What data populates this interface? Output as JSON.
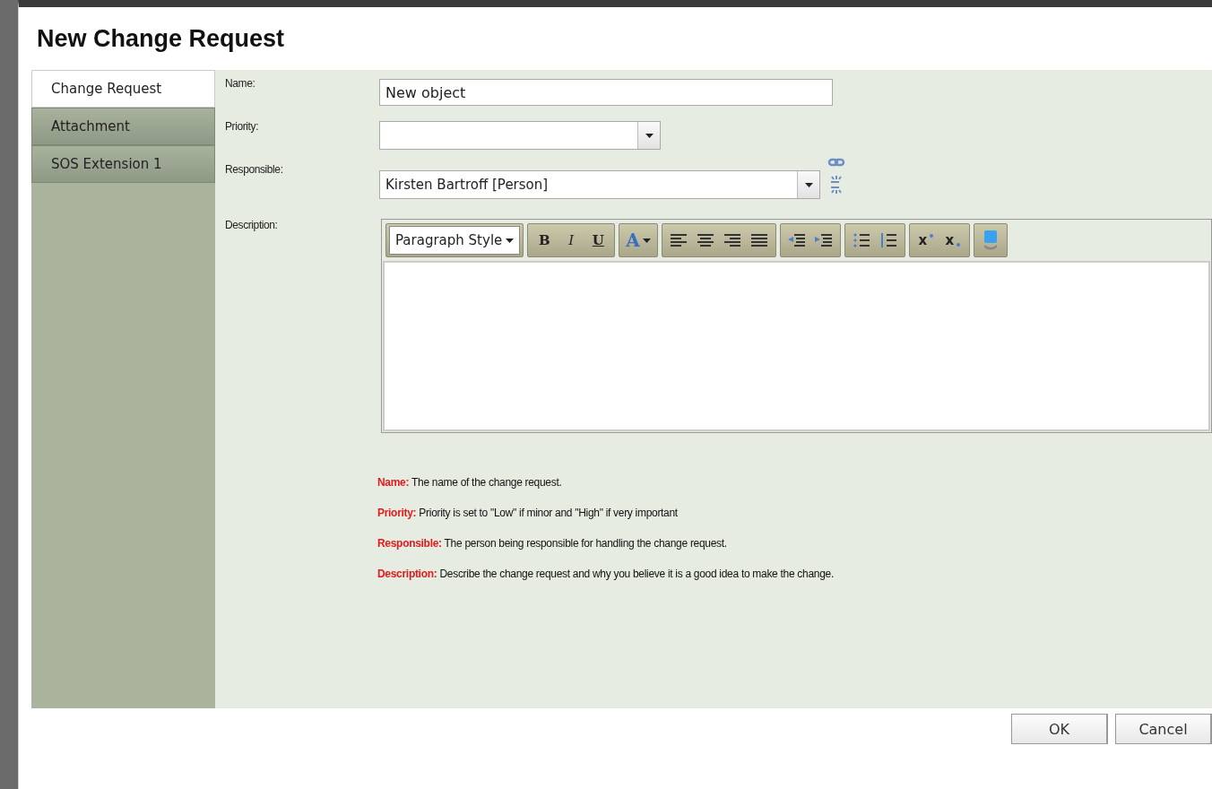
{
  "dialog": {
    "title": "New Change Request"
  },
  "tabs": [
    {
      "label": "Change Request",
      "selected": true
    },
    {
      "label": "Attachment",
      "selected": false
    },
    {
      "label": "SOS Extension 1",
      "selected": false
    }
  ],
  "fields": [
    {
      "kind": "text",
      "label": "Name:",
      "value": "New object"
    },
    {
      "kind": "select",
      "label": "Priority:"
    },
    {
      "kind": "lookup",
      "label": "Responsible:",
      "value": "Kirsten Bartroff [Person]"
    },
    {
      "kind": "richtext",
      "label": "Description:"
    }
  ],
  "toolbar": [
    [
      {
        "kind": "style",
        "label": "Paragraph Style"
      }
    ],
    [
      {
        "kind": "bold",
        "label": "B"
      },
      {
        "kind": "italic",
        "label": "I"
      },
      {
        "kind": "underline",
        "label": "U"
      }
    ],
    [
      {
        "kind": "color",
        "label": "A"
      }
    ],
    [
      {
        "kind": "align-left"
      },
      {
        "kind": "align-center"
      },
      {
        "kind": "align-right"
      },
      {
        "kind": "justify"
      }
    ],
    [
      {
        "kind": "outdent"
      },
      {
        "kind": "indent"
      }
    ],
    [
      {
        "kind": "bullets"
      },
      {
        "kind": "numbers"
      }
    ],
    [
      {
        "kind": "superscript",
        "label": "x"
      },
      {
        "kind": "subscript",
        "label": "x"
      }
    ],
    [
      {
        "kind": "media"
      }
    ]
  ],
  "help": [
    {
      "term": "Name:",
      "text": "The name of the change request."
    },
    {
      "term": "Priority:",
      "text": "Priority is set to \"Low\" if minor and \"High\" if very important"
    },
    {
      "term": "Responsible:",
      "text": "The person being responsible for handling the change request."
    },
    {
      "term": "Description:",
      "text": "Describe the change request and why you believe it is a good idea to make the change."
    }
  ],
  "buttons": [
    "OK",
    "Cancel"
  ]
}
